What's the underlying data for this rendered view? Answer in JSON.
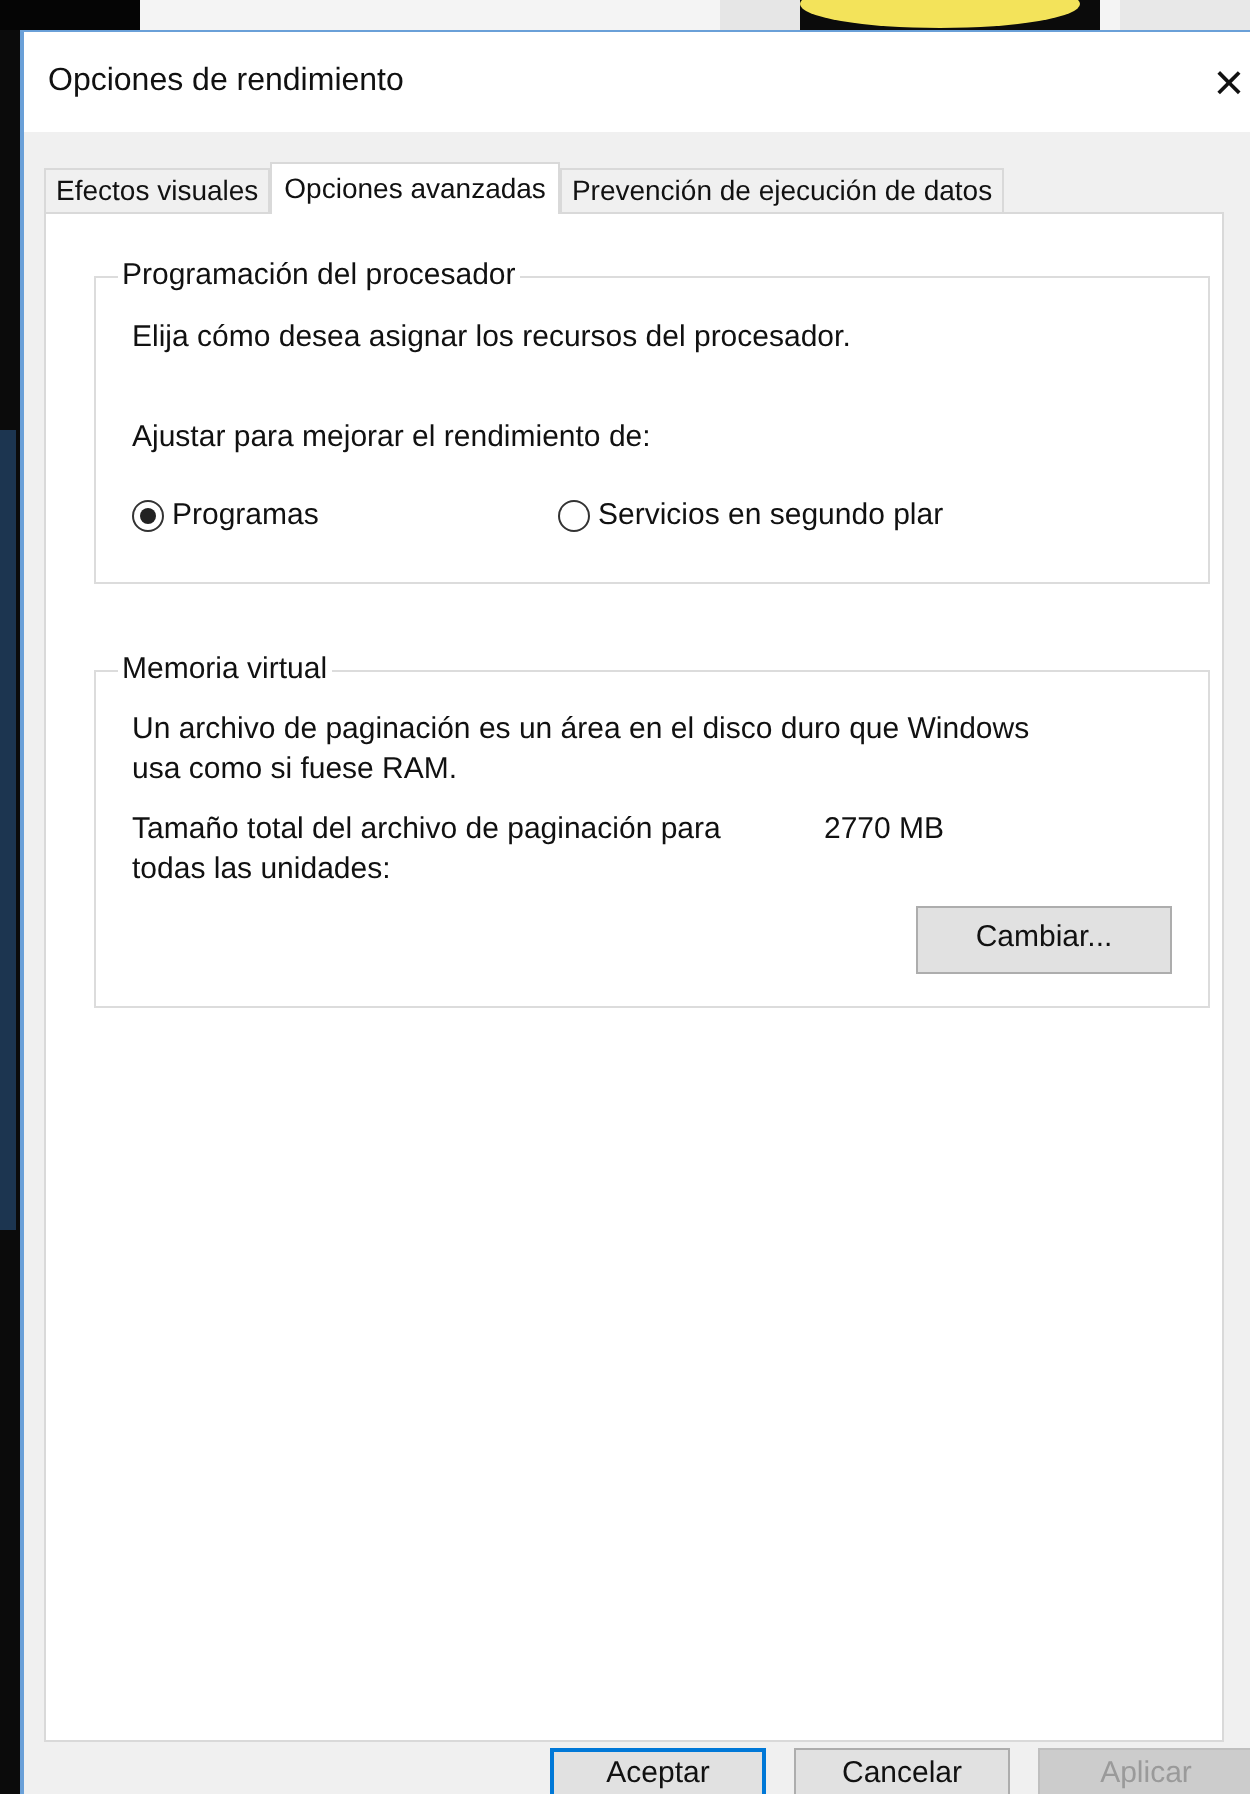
{
  "window": {
    "title": "Opciones de rendimiento",
    "close": "×"
  },
  "tabs": [
    {
      "label": "Efectos visuales",
      "selected": false
    },
    {
      "label": "Opciones avanzadas",
      "selected": true
    },
    {
      "label": "Prevención de ejecución de datos",
      "selected": false
    }
  ],
  "processor_group": {
    "title": "Programación del procesador",
    "description": "Elija cómo desea asignar los recursos del procesador.",
    "prompt": "Ajustar para mejorar el rendimiento de:",
    "options": [
      {
        "label": "Programas",
        "selected": true
      },
      {
        "label": "Servicios en segundo plar",
        "selected": false
      }
    ]
  },
  "memory_group": {
    "title": "Memoria virtual",
    "description": "Un archivo de paginación es un área en el disco duro que Windows usa como si fuese RAM.",
    "size_label": "Tamaño total del archivo de paginación para todas las unidades:",
    "size_value": "2770 MB",
    "change_button": "Cambiar..."
  },
  "buttons": [
    {
      "label": "Aceptar",
      "default": true,
      "disabled": false
    },
    {
      "label": "Cancelar",
      "default": false,
      "disabled": false
    },
    {
      "label": "Aplicar",
      "default": false,
      "disabled": true
    }
  ]
}
